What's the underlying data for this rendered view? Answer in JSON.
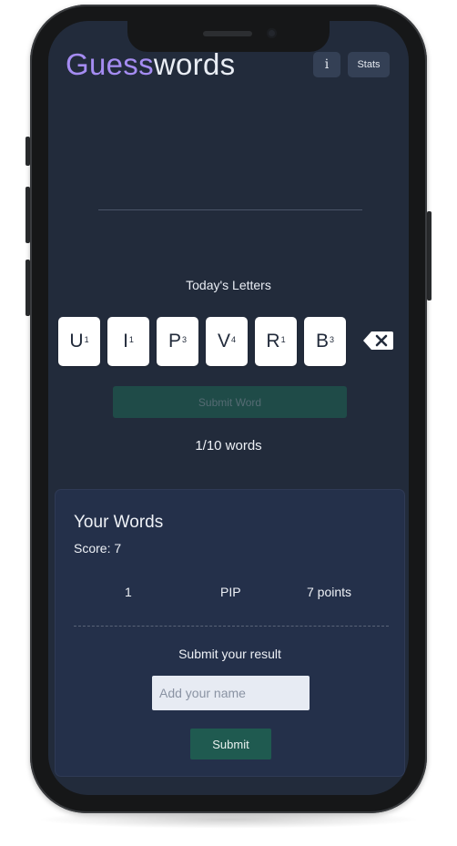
{
  "header": {
    "title_part1": "Guess",
    "title_part2": "words",
    "info_label": "i",
    "stats_label": "Stats"
  },
  "game": {
    "letters_heading": "Today's Letters",
    "tiles": [
      {
        "letter": "U",
        "points": "1"
      },
      {
        "letter": "I",
        "points": "1"
      },
      {
        "letter": "P",
        "points": "3"
      },
      {
        "letter": "V",
        "points": "4"
      },
      {
        "letter": "R",
        "points": "1"
      },
      {
        "letter": "B",
        "points": "3"
      }
    ],
    "backspace_icon": "backspace-icon",
    "submit_word_label": "Submit Word",
    "progress": "1/10 words"
  },
  "your_words": {
    "title": "Your Words",
    "score": "Score: 7",
    "rows": [
      {
        "index": "1",
        "word": "PIP",
        "points": "7 points"
      }
    ],
    "submit_heading": "Submit your result",
    "name_placeholder": "Add your name",
    "submit_label": "Submit"
  },
  "colors": {
    "background": "#222b3b",
    "accent_purple": "#a58cf2",
    "button_teal": "#1f5a50",
    "card": "#24304a"
  }
}
